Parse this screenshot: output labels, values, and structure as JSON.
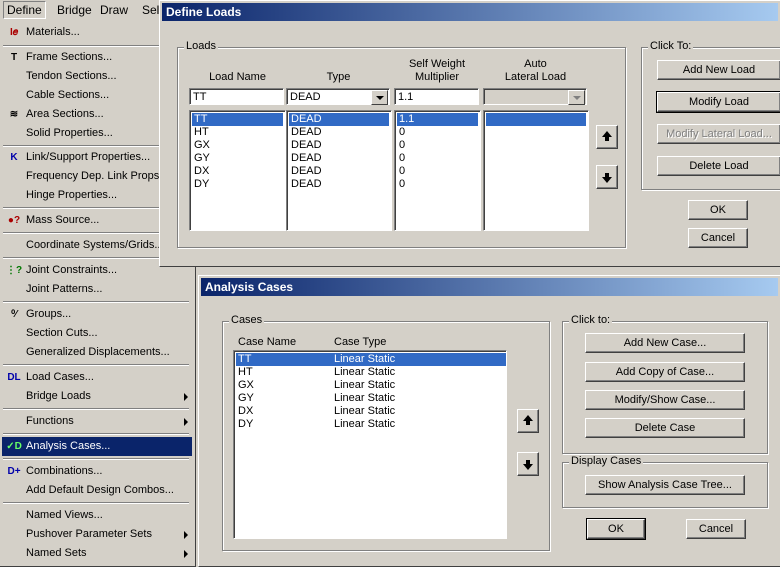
{
  "menubar": {
    "items": [
      "Define",
      "Bridge",
      "Draw",
      "Sel"
    ]
  },
  "menu": {
    "items": [
      {
        "label": "Materials...",
        "icon": "materials-icon",
        "glyph": "I𝑒"
      },
      {
        "label": "Frame Sections...",
        "icon": "frame-sections-icon",
        "glyph": "T"
      },
      {
        "label": "Tendon Sections...",
        "icon": "",
        "glyph": ""
      },
      {
        "label": "Cable Sections...",
        "icon": "",
        "glyph": ""
      },
      {
        "label": "Area Sections...",
        "icon": "area-sections-icon",
        "glyph": "≋"
      },
      {
        "label": "Solid Properties...",
        "icon": "",
        "glyph": ""
      },
      {
        "label": "Link/Support Properties...",
        "icon": "link-support-icon",
        "glyph": "K"
      },
      {
        "label": "Frequency Dep. Link Props...",
        "icon": "",
        "glyph": ""
      },
      {
        "label": "Hinge Properties...",
        "icon": "",
        "glyph": ""
      },
      {
        "label": "Mass  Source...",
        "icon": "mass-source-icon",
        "glyph": "●?"
      },
      {
        "label": "Coordinate Systems/Grids...",
        "icon": "",
        "glyph": ""
      },
      {
        "label": "Joint Constraints...",
        "icon": "joint-constraints-icon",
        "glyph": "⋮?"
      },
      {
        "label": "Joint Patterns...",
        "icon": "",
        "glyph": ""
      },
      {
        "label": "Groups...",
        "icon": "groups-icon",
        "glyph": "⁰⁄"
      },
      {
        "label": "Section Cuts...",
        "icon": "",
        "glyph": ""
      },
      {
        "label": "Generalized Displacements...",
        "icon": "",
        "glyph": ""
      },
      {
        "label": "Load Cases...",
        "icon": "load-cases-icon",
        "glyph": "DL"
      },
      {
        "label": "Bridge Loads",
        "icon": "",
        "glyph": ""
      },
      {
        "label": "Functions",
        "icon": "",
        "glyph": ""
      },
      {
        "label": "Analysis Cases...",
        "icon": "analysis-cases-icon",
        "glyph": "✓D"
      },
      {
        "label": "Combinations...",
        "icon": "combinations-icon",
        "glyph": "D+"
      },
      {
        "label": "Add Default Design Combos...",
        "icon": "",
        "glyph": ""
      },
      {
        "label": "Named Views...",
        "icon": "",
        "glyph": ""
      },
      {
        "label": "Pushover Parameter Sets",
        "icon": "",
        "glyph": ""
      },
      {
        "label": "Named Sets",
        "icon": "",
        "glyph": ""
      }
    ]
  },
  "define_loads": {
    "title": "Define Loads",
    "loads_group": "Loads",
    "col_load_name": "Load Name",
    "col_type": "Type",
    "col_self_weight": "Self Weight\nMultiplier",
    "col_auto_lateral": "Auto\nLateral Load",
    "edit_name": "TT",
    "edit_type": "DEAD",
    "edit_multiplier": "1.1",
    "rows": [
      {
        "name": "TT",
        "type": "DEAD",
        "mult": "1.1"
      },
      {
        "name": "HT",
        "type": "DEAD",
        "mult": "0"
      },
      {
        "name": "GX",
        "type": "DEAD",
        "mult": "0"
      },
      {
        "name": "GY",
        "type": "DEAD",
        "mult": "0"
      },
      {
        "name": "DX",
        "type": "DEAD",
        "mult": "0"
      },
      {
        "name": "DY",
        "type": "DEAD",
        "mult": "0"
      }
    ],
    "click_to": "Click To:",
    "add_new_load": "Add New Load",
    "modify_load": "Modify Load",
    "modify_lateral_load": "Modify Lateral Load...",
    "delete_load": "Delete Load",
    "ok": "OK",
    "cancel": "Cancel"
  },
  "analysis_cases": {
    "title": "Analysis Cases",
    "cases_group": "Cases",
    "col_case_name": "Case Name",
    "col_case_type": "Case Type",
    "rows": [
      {
        "name": "TT",
        "type": "Linear Static"
      },
      {
        "name": "HT",
        "type": "Linear Static"
      },
      {
        "name": "GX",
        "type": "Linear Static"
      },
      {
        "name": "GY",
        "type": "Linear Static"
      },
      {
        "name": "DX",
        "type": "Linear Static"
      },
      {
        "name": "DY",
        "type": "Linear Static"
      }
    ],
    "click_to": "Click to:",
    "add_new_case": "Add New Case...",
    "add_copy_of_case": "Add Copy of Case...",
    "modify_show_case": "Modify/Show Case...",
    "delete_case": "Delete Case",
    "display_cases": "Display Cases",
    "show_tree": "Show Analysis Case Tree...",
    "ok": "OK",
    "cancel": "Cancel"
  },
  "colors": {
    "title_blue": "#0a246a",
    "selection": "#316ac5",
    "face": "#d4d0c8"
  }
}
